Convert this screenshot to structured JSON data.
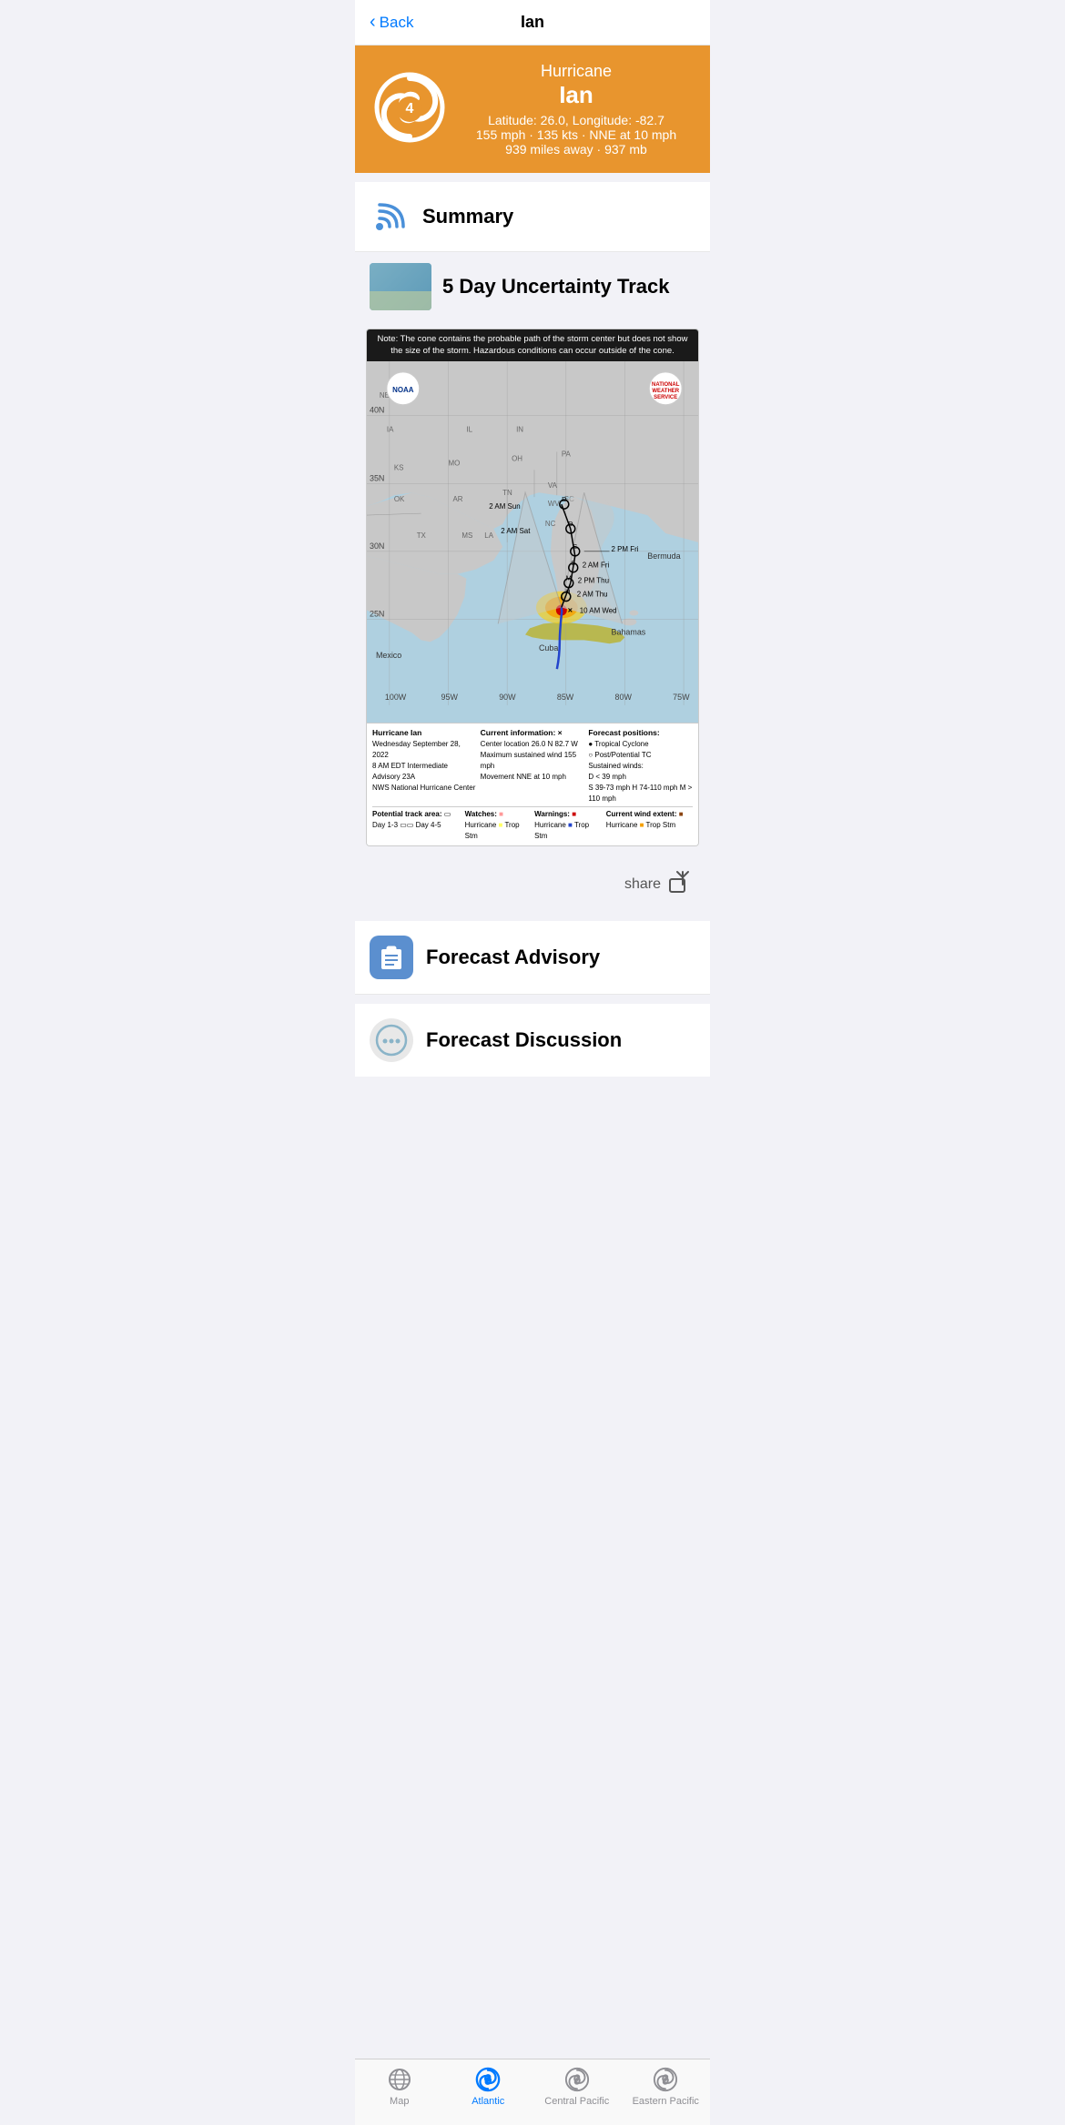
{
  "nav": {
    "back_label": "Back",
    "title": "Ian"
  },
  "storm_header": {
    "type": "Hurricane",
    "name": "Ian",
    "category": "4",
    "latitude": "26.0",
    "longitude": "-82.7",
    "coords_label": "Latitude: 26.0, Longitude: -82.7",
    "speeds_label": "155 mph · 135 kts · NNE at 10 mph",
    "distance_label": "939 miles away · 937 mb"
  },
  "summary_section": {
    "title": "Summary"
  },
  "track_section": {
    "title": "5 Day Uncertainty Track",
    "map_note": "Note: The cone contains the probable path of the storm center but does not show\nthe size of the storm. Hazardous conditions can occur outside of the cone.",
    "legend": {
      "current_info_title": "Current information: ×",
      "center_location": "Center location 26.0 N 82.7 W",
      "max_wind": "Maximum sustained wind 155 mph",
      "movement": "Movement NNE at 10 mph",
      "forecast_title": "Forecast positions:",
      "tc_label": "● Tropical Cyclone",
      "potential_label": "○ Post/Potential TC",
      "winds_label": "Sustained winds:",
      "d_label": "D < 39 mph",
      "s_label": "S 39-73 mph   H 74-110 mph   M > 110 mph",
      "source_title": "Hurricane Ian",
      "source_date": "Wednesday September 28, 2022",
      "source_time": "8 AM EDT Intermediate Advisory 23A",
      "source_org": "NWS National Hurricane Center",
      "track_title": "Potential track area:",
      "track_day13": "Day 1-3",
      "track_day45": "Day 4-5",
      "watches_title": "Watches:",
      "hurricane_watch": "Hurricane",
      "trop_watch": "Trop Stm",
      "warnings_title": "Warnings:",
      "hurricane_warn": "Hurricane",
      "trop_warn": "Trop Stm",
      "wind_title": "Current wind extent:",
      "wind_hurricane": "Hurricane",
      "wind_trop": "Trop Stm"
    }
  },
  "share": {
    "label": "share"
  },
  "forecast_advisory": {
    "title": "Forecast Advisory"
  },
  "forecast_discussion": {
    "title": "Forecast Discussion"
  },
  "tab_bar": {
    "tabs": [
      {
        "id": "map",
        "label": "Map",
        "active": false
      },
      {
        "id": "atlantic",
        "label": "Atlantic",
        "active": true
      },
      {
        "id": "central_pacific",
        "label": "Central Pacific",
        "active": false
      },
      {
        "id": "eastern_pacific",
        "label": "Eastern Pacific",
        "active": false
      }
    ]
  }
}
